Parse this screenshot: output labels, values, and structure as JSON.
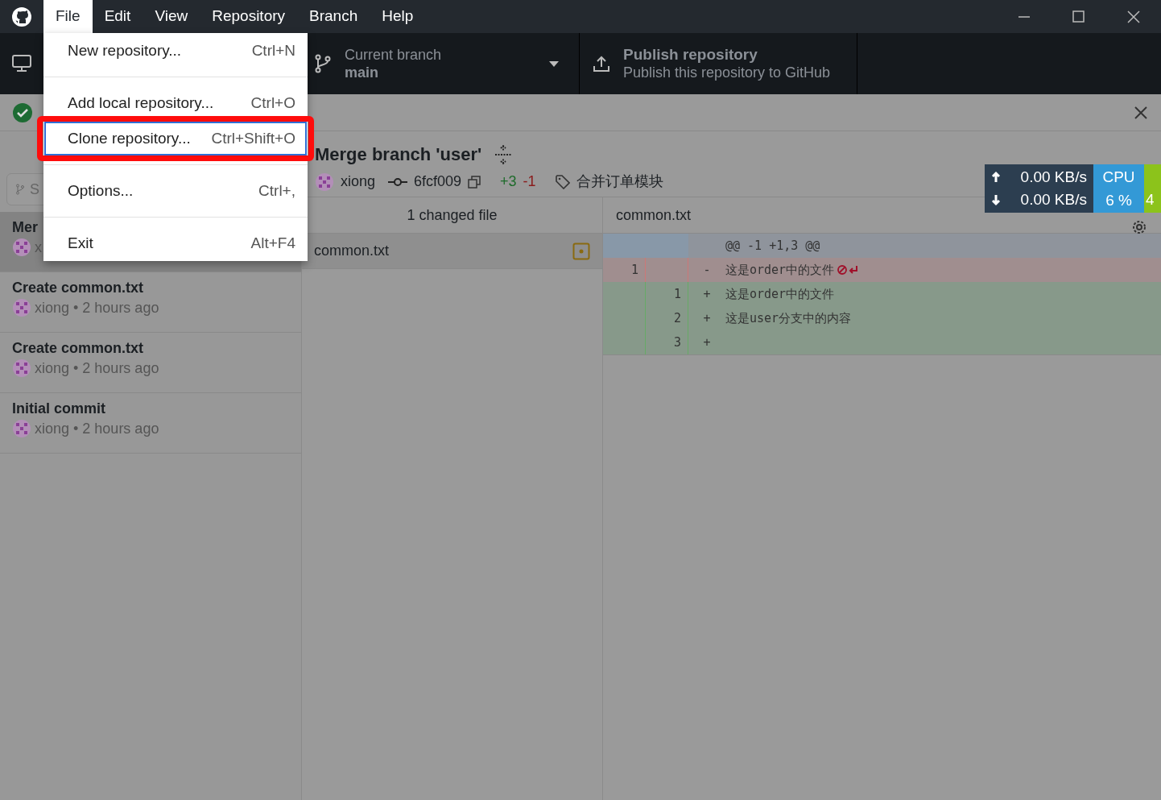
{
  "menu_bar": {
    "items": [
      {
        "label": "File",
        "selected": true
      },
      {
        "label": "Edit",
        "selected": false
      },
      {
        "label": "View",
        "selected": false
      },
      {
        "label": "Repository",
        "selected": false
      },
      {
        "label": "Branch",
        "selected": false
      },
      {
        "label": "Help",
        "selected": false
      }
    ]
  },
  "file_menu": {
    "items": [
      {
        "label": "New repository...",
        "shortcut": "Ctrl+N",
        "highlighted": false
      },
      {
        "label": "Add local repository...",
        "shortcut": "Ctrl+O",
        "highlighted": false
      },
      {
        "label": "Clone repository...",
        "shortcut": "Ctrl+Shift+O",
        "highlighted": true
      },
      {
        "label": "Options...",
        "shortcut": "Ctrl+,",
        "highlighted": false
      },
      {
        "label": "Exit",
        "shortcut": "Alt+F4",
        "highlighted": false
      }
    ]
  },
  "toolbar": {
    "branch_label": "Current branch",
    "branch": "main",
    "publish_title": "Publish repository",
    "publish_subtitle": "Publish this repository to GitHub"
  },
  "sidebar": {
    "filter_placeholder": "S",
    "commits": [
      {
        "title": "Mer",
        "author": "x",
        "selected": true
      },
      {
        "title": "Create common.txt",
        "author": "xiong • 2 hours ago",
        "selected": false
      },
      {
        "title": "Create common.txt",
        "author": "xiong • 2 hours ago",
        "selected": false
      },
      {
        "title": "Initial commit",
        "author": "xiong • 2 hours ago",
        "selected": false
      }
    ]
  },
  "commit": {
    "title": "Merge branch 'user'",
    "author": "xiong",
    "sha": "6fcf009",
    "additions": "+3",
    "deletions": "-1",
    "tag": "合并订单模块"
  },
  "files": {
    "header": "1 changed file",
    "items": [
      {
        "name": "common.txt",
        "selected": true
      }
    ]
  },
  "diff": {
    "file": "common.txt",
    "hunk": "@@ -1 +1,3 @@",
    "lines": [
      {
        "kind": "removed",
        "old": "1",
        "sign": "-",
        "text": "这是order中的文件",
        "no_newline": true
      },
      {
        "kind": "added",
        "new": "1",
        "sign": "+",
        "text": "这是order中的文件"
      },
      {
        "kind": "added",
        "new": "2",
        "sign": "+",
        "text": "这是user分支中的内容"
      },
      {
        "kind": "added",
        "new": "3",
        "sign": "+"
      }
    ]
  },
  "net_widget": {
    "upload": "0.00 KB/s",
    "download": "0.00 KB/s",
    "cpu_label": "CPU",
    "cpu_value": "6 %",
    "mem_value": "4"
  }
}
